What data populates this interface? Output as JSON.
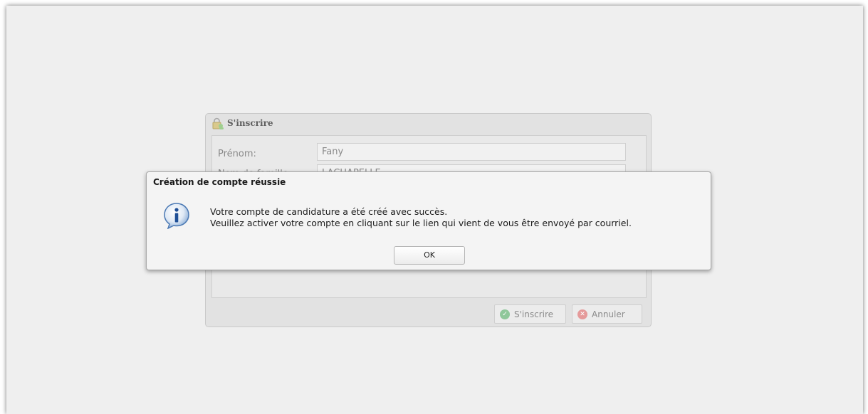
{
  "registration": {
    "title": "S'inscrire",
    "fields": [
      {
        "label": "Prénom:",
        "value": "Fany"
      },
      {
        "label": "Nom de famille:",
        "value": "LACHAPELLE"
      }
    ],
    "buttons": {
      "signup": "S'inscrire",
      "cancel": "Annuler"
    }
  },
  "dialog": {
    "title": "Création de compte réussie",
    "line1": "Votre compte de candidature a été créé avec succès.",
    "line2": "Veuillez activer votre compte en cliquant sur le lien qui vient de vous être envoyé par courriel.",
    "ok_label": "OK"
  },
  "icons": {
    "window": "lock-user-icon",
    "info": "info-icon",
    "signup": "check-circle-icon",
    "cancel": "cancel-circle-icon"
  }
}
